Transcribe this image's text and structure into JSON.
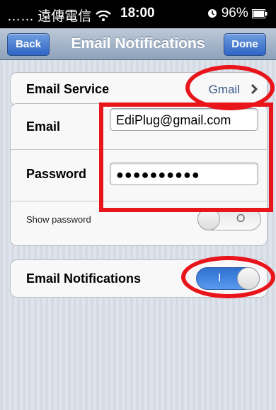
{
  "status_bar": {
    "carrier": "…… 遠傳電信",
    "time": "18:00",
    "battery": "96%"
  },
  "nav": {
    "title": "Email Notifications",
    "back_label": "Back",
    "done_label": "Done"
  },
  "email_service": {
    "label": "Email Service",
    "value": "Gmail"
  },
  "account": {
    "email_label": "Email",
    "email_value": "EdiPlug@gmail.com",
    "password_label": "Password",
    "password_value": "●●●●●●●●●●",
    "show_password_label": "Show password",
    "show_password_mark": "O"
  },
  "notifications": {
    "label": "Email Notifications",
    "toggle_mark": "I"
  },
  "colors": {
    "annotation": "#e8151b",
    "toggle_on": "#3a7ce0",
    "nav_button": "#2f65c5"
  }
}
